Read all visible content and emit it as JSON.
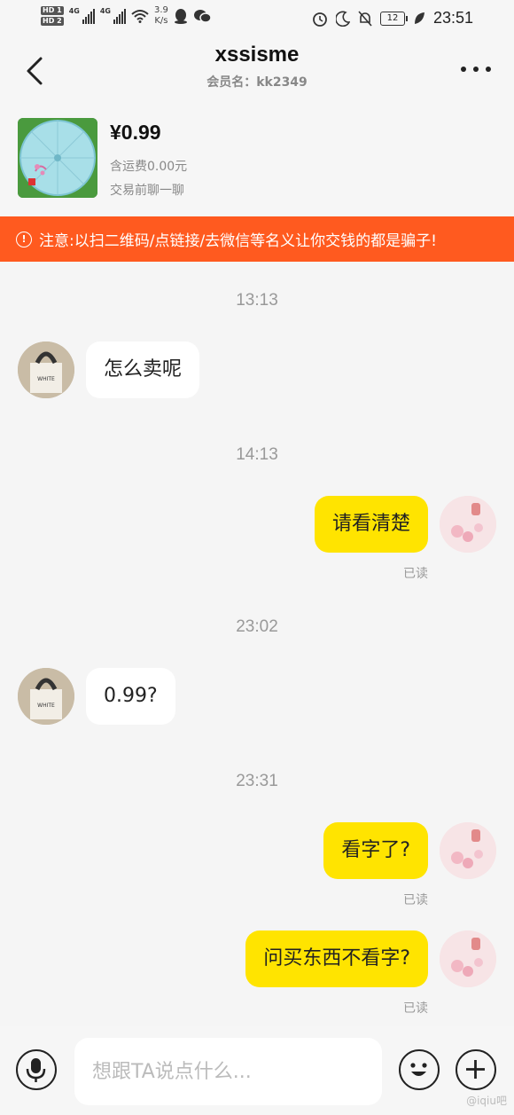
{
  "status_bar": {
    "hd1": "HD 1",
    "hd2": "HD 2",
    "network_type_1": "4G",
    "network_type_2": "4G",
    "speed_value": "3.9",
    "speed_unit": "K/s",
    "battery": "12",
    "time": "23:51"
  },
  "header": {
    "title": "xssisme",
    "subtitle": "会员名：kk2349"
  },
  "product": {
    "price": "¥0.99",
    "shipping": "含运费0.00元",
    "hint": "交易前聊一聊"
  },
  "warning": {
    "text": "注意:以扫二维码/点链接/去微信等名义让你交钱的都是骗子!"
  },
  "messages": [
    {
      "timestamp": "13:13",
      "from": "other",
      "text": "怎么卖呢"
    },
    {
      "timestamp": "14:13",
      "from": "me",
      "text": "请看清楚",
      "status": "已读"
    },
    {
      "timestamp": "23:02",
      "from": "other",
      "text": "0.99?"
    },
    {
      "timestamp": "23:31",
      "from": "me",
      "text": "看字了?",
      "status": "已读"
    },
    {
      "from": "me",
      "text": "问买东西不看字?",
      "status": "已读"
    }
  ],
  "input": {
    "placeholder": "想跟TA说点什么..."
  },
  "watermark": "@iqiu吧",
  "colors": {
    "accent_yellow": "#ffe400",
    "warning_orange": "#ff5a1f",
    "background": "#f5f5f5"
  }
}
